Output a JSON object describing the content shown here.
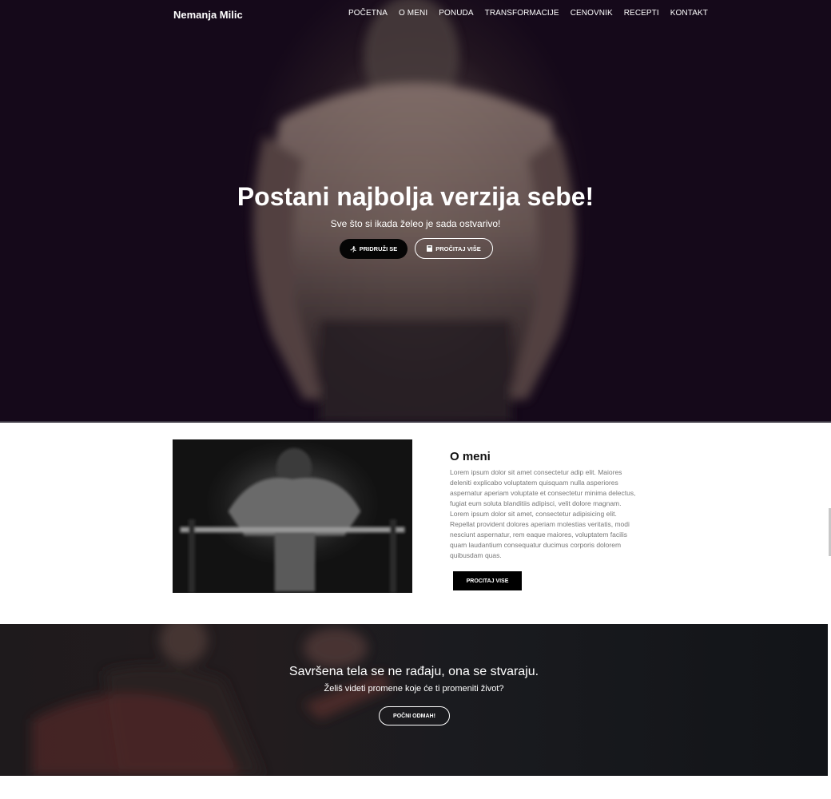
{
  "nav": {
    "brand": "Nemanja Milic",
    "links": [
      "POČETNA",
      "O MENI",
      "PONUDA",
      "TRANSFORMACIJE",
      "CENOVNIK",
      "RECEPTI",
      "KONTAKT"
    ]
  },
  "hero": {
    "title": "Postani najbolja verzija sebe!",
    "subtitle": "Sve što si ikada želeo je sada ostvarivo!",
    "join_label": "PRIDRUŽI SE",
    "join_icon": "running-icon",
    "read_label": "PROČITAJ VIŠE",
    "read_icon": "book-icon"
  },
  "about": {
    "title": "O meni",
    "text": "Lorem ipsum dolor sit amet consectetur adip elit. Maiores deleniti explicabo voluptatem quisquam nulla asperiores aspernatur aperiam voluptate et consectetur minima delectus, fugiat eum soluta blanditiis adipisci, velit dolore magnam. Lorem ipsum dolor sit amet, consectetur adipisicing elit. Repellat provident dolores aperiam molestias veritatis, modi nesciunt aspernatur, rem eaque maiores, voluptatem facilis quam laudantium consequatur ducimus corporis dolorem quibusdam quas.",
    "button_label": "PROCITAJ VISE"
  },
  "cta": {
    "title": "Savršena tela se ne rađaju, ona se stvaraju.",
    "subtitle": "Želiš videti promene koje će ti promeniti život?",
    "button_label": "POČNI ODMAH!"
  },
  "colors": {
    "hero_bg": "#15091a",
    "cta_bg": "#121418",
    "button_dark": "#000000"
  }
}
